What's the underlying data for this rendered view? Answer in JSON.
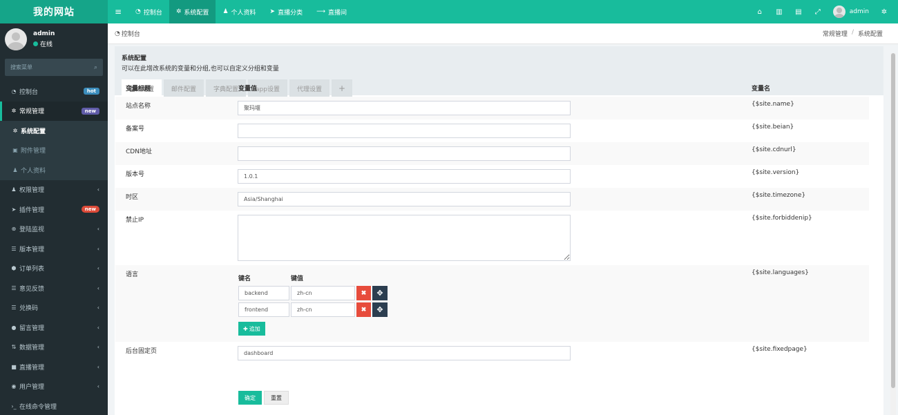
{
  "brand": "我的网站",
  "topnav": [
    {
      "icon": "dashboard-icon",
      "glyph": "◔",
      "label": "控制台"
    },
    {
      "icon": "gear-icon",
      "glyph": "✲",
      "label": "系统配置"
    },
    {
      "icon": "user-icon",
      "glyph": "♟",
      "label": "个人资料"
    },
    {
      "icon": "send-icon",
      "glyph": "➤",
      "label": "直播分类"
    },
    {
      "icon": "arrow-right-icon",
      "glyph": "⟶",
      "label": "直播间"
    }
  ],
  "top_user": "admin",
  "user": {
    "name": "admin",
    "status": "在线"
  },
  "search": {
    "placeholder": "搜索菜单"
  },
  "menu": [
    {
      "label": "控制台",
      "badge": "hot"
    },
    {
      "label": "常规管理",
      "badge": "new"
    },
    {
      "label": "系统配置"
    },
    {
      "label": "附件管理"
    },
    {
      "label": "个人资料"
    },
    {
      "label": "权限管理"
    },
    {
      "label": "插件管理",
      "badge": "new"
    },
    {
      "label": "登陆监视"
    },
    {
      "label": "版本管理"
    },
    {
      "label": "订单列表"
    },
    {
      "label": "意见反馈"
    },
    {
      "label": "兑换码"
    },
    {
      "label": "留言管理"
    },
    {
      "label": "数据管理"
    },
    {
      "label": "直播管理"
    },
    {
      "label": "用户管理"
    },
    {
      "label": "在线命令管理"
    }
  ],
  "breadcrumb": {
    "current": "控制台",
    "path": [
      "常规管理",
      "系统配置"
    ]
  },
  "panel": {
    "title": "系统配置",
    "desc": "可以在此增改系统的变量和分组,也可以自定义分组和变量",
    "tabs": [
      "基础配置",
      "邮件配置",
      "字典配置",
      "app设置",
      "代理设置",
      "+"
    ]
  },
  "table": {
    "headers": [
      "变量标题",
      "变量值",
      "变量名"
    ],
    "rows": [
      {
        "title": "站点名称",
        "value": "聚玛堰",
        "var": "{$site.name}"
      },
      {
        "title": "备案号",
        "value": "",
        "var": "{$site.beian}"
      },
      {
        "title": "CDN地址",
        "value": "",
        "var": "{$site.cdnurl}"
      },
      {
        "title": "版本号",
        "value": "1.0.1",
        "var": "{$site.version}"
      },
      {
        "title": "时区",
        "value": "Asia/Shanghai",
        "var": "{$site.timezone}"
      },
      {
        "title": "禁止IP",
        "value": "",
        "var": "{$site.forbiddenip}"
      },
      {
        "title": "语言",
        "var": "{$site.languages}"
      },
      {
        "title": "后台固定页",
        "value": "dashboard",
        "var": "{$site.fixedpage}"
      }
    ]
  },
  "languages": {
    "key_header": "键名",
    "value_header": "键值",
    "items": [
      {
        "key": "backend",
        "value": "zh-cn"
      },
      {
        "key": "frontend",
        "value": "zh-cn"
      }
    ],
    "add_label": "追加"
  },
  "actions": {
    "ok": "确定",
    "reset": "重置"
  },
  "colors": {
    "primary": "#18bc9c",
    "sidebar": "#222d32",
    "danger": "#e74c3c",
    "dark": "#2c3e50"
  }
}
